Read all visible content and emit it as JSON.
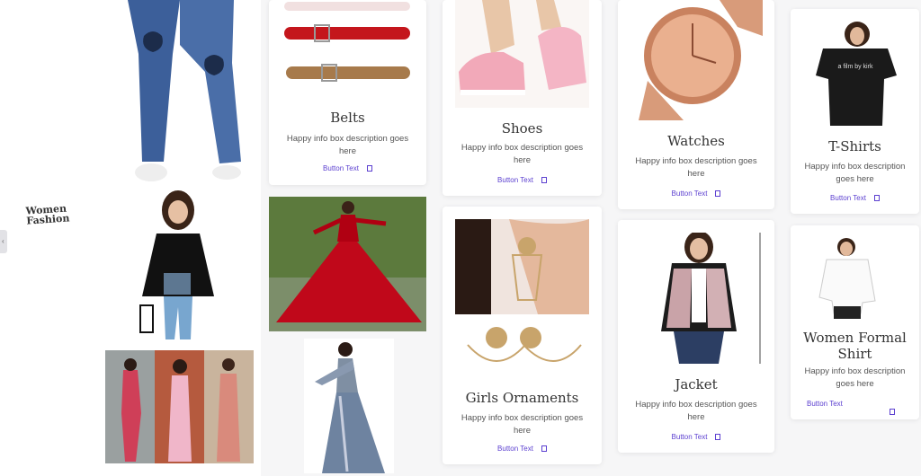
{
  "side_panel": {
    "logo_line1": "Women",
    "logo_line2": "Fashion"
  },
  "cards": {
    "belts": {
      "title": "Belts",
      "desc": "Happy info box description goes here",
      "button": "Button Text"
    },
    "shoes": {
      "title": "Shoes",
      "desc": "Happy info box description goes here",
      "button": "Button Text"
    },
    "watches": {
      "title": "Watches",
      "desc": "Happy info box description goes here",
      "button": "Button Text"
    },
    "tshirts": {
      "title": "T-Shirts",
      "desc": "Happy info box description goes here",
      "button": "Button Text"
    },
    "ornaments": {
      "title": "Girls Ornaments",
      "desc": "Happy info box description goes here",
      "button": "Button Text"
    },
    "jacket": {
      "title": "Jacket",
      "desc": "Happy info box description goes here",
      "button": "Button Text"
    },
    "formal": {
      "title": "Women Formal Shirt",
      "desc": "Happy info box description goes here",
      "button": "Button Text"
    }
  },
  "tshirt_print": "a film by kirk",
  "colors": {
    "accent": "#5b3fd0",
    "card_bg": "#ffffff",
    "page_bg": "#f6f6f7"
  }
}
